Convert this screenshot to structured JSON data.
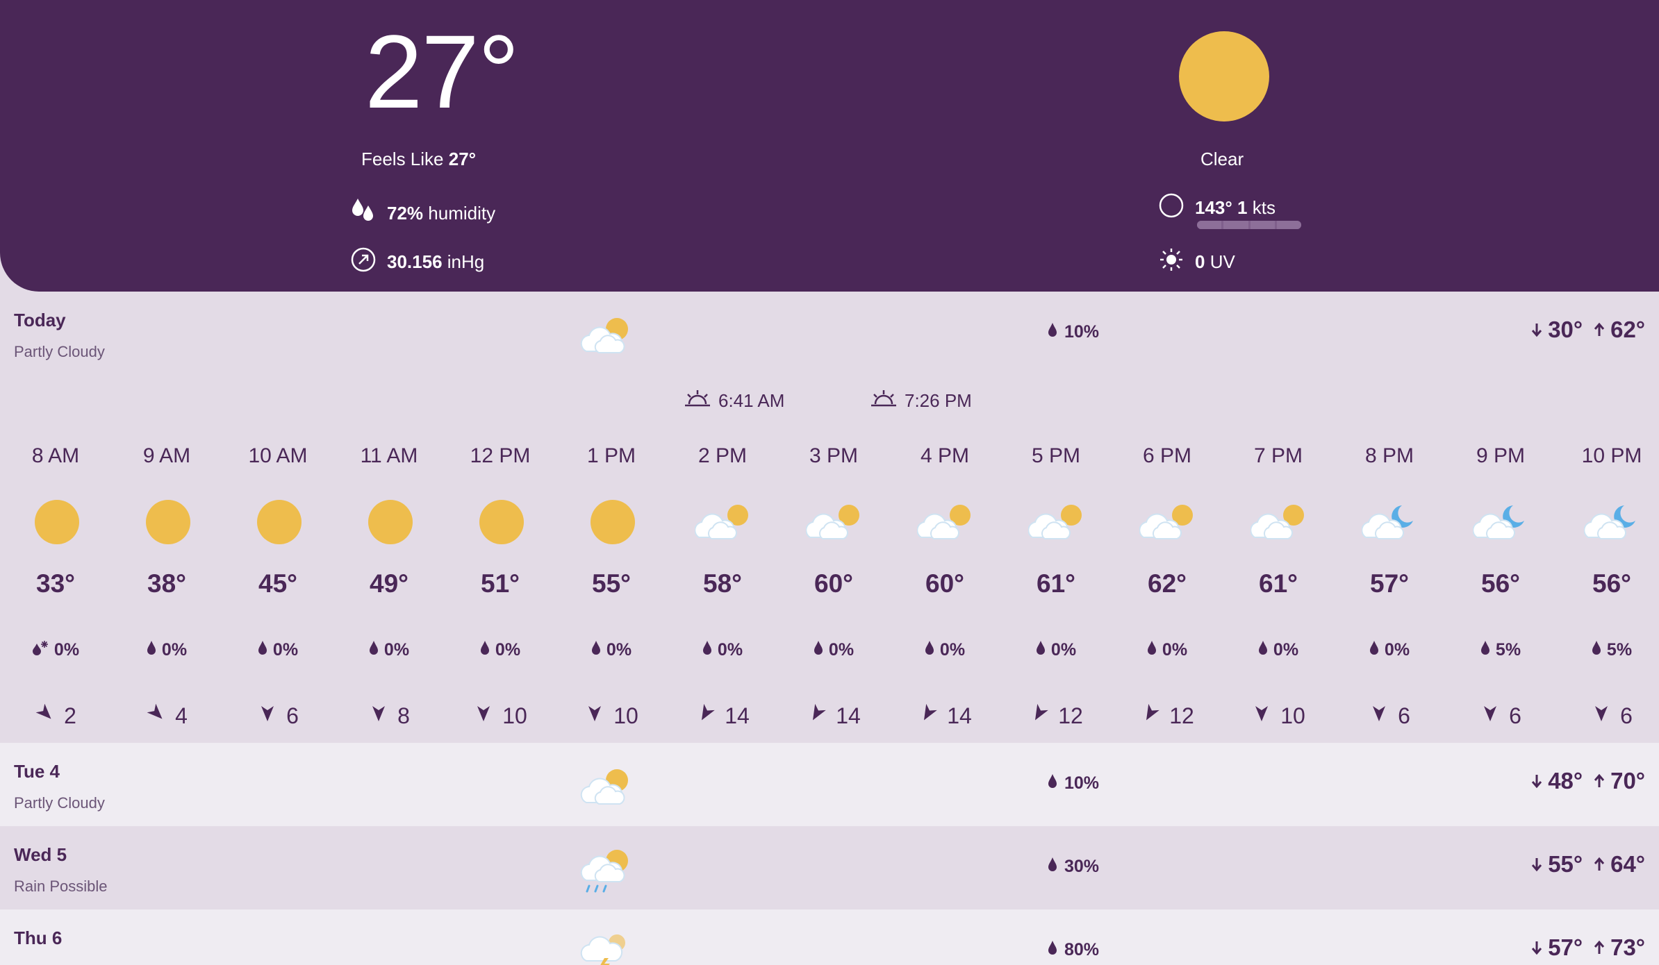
{
  "current": {
    "temperature": "27°",
    "feels_like_label": "Feels Like",
    "feels_like_value": "27°",
    "humidity_value": "72%",
    "humidity_label": "humidity",
    "pressure_value": "30.156",
    "pressure_unit": "inHg",
    "condition": "Clear",
    "wind_direction": "143°",
    "wind_speed": "1",
    "wind_unit": "kts",
    "uv_value": "0",
    "uv_label": "UV"
  },
  "today": {
    "day": "Today",
    "condition": "Partly Cloudy",
    "precip": "10%",
    "low": "30°",
    "high": "62°",
    "sunrise": "6:41 AM",
    "sunset": "7:26 PM"
  },
  "hours": [
    {
      "time": "8 AM",
      "icon": "sun-icon",
      "temp": "33°",
      "precip_icon": "snow-drop-icon",
      "precip": "0%",
      "wind_dir": "se",
      "wind": "2"
    },
    {
      "time": "9 AM",
      "icon": "sun-icon",
      "temp": "38°",
      "precip_icon": "drop-icon",
      "precip": "0%",
      "wind_dir": "se",
      "wind": "4"
    },
    {
      "time": "10 AM",
      "icon": "sun-icon",
      "temp": "45°",
      "precip_icon": "drop-icon",
      "precip": "0%",
      "wind_dir": "s",
      "wind": "6"
    },
    {
      "time": "11 AM",
      "icon": "sun-icon",
      "temp": "49°",
      "precip_icon": "drop-icon",
      "precip": "0%",
      "wind_dir": "s",
      "wind": "8"
    },
    {
      "time": "12 PM",
      "icon": "sun-icon",
      "temp": "51°",
      "precip_icon": "drop-icon",
      "precip": "0%",
      "wind_dir": "s",
      "wind": "10"
    },
    {
      "time": "1 PM",
      "icon": "sun-icon",
      "temp": "55°",
      "precip_icon": "drop-icon",
      "precip": "0%",
      "wind_dir": "s",
      "wind": "10"
    },
    {
      "time": "2 PM",
      "icon": "partly-cloudy-day-icon",
      "temp": "58°",
      "precip_icon": "drop-icon",
      "precip": "0%",
      "wind_dir": "sw",
      "wind": "14"
    },
    {
      "time": "3 PM",
      "icon": "partly-cloudy-day-icon",
      "temp": "60°",
      "precip_icon": "drop-icon",
      "precip": "0%",
      "wind_dir": "sw",
      "wind": "14"
    },
    {
      "time": "4 PM",
      "icon": "partly-cloudy-day-icon",
      "temp": "60°",
      "precip_icon": "drop-icon",
      "precip": "0%",
      "wind_dir": "sw",
      "wind": "14"
    },
    {
      "time": "5 PM",
      "icon": "partly-cloudy-day-icon",
      "temp": "61°",
      "precip_icon": "drop-icon",
      "precip": "0%",
      "wind_dir": "sw",
      "wind": "12"
    },
    {
      "time": "6 PM",
      "icon": "partly-cloudy-day-icon",
      "temp": "62°",
      "precip_icon": "drop-icon",
      "precip": "0%",
      "wind_dir": "sw",
      "wind": "12"
    },
    {
      "time": "7 PM",
      "icon": "partly-cloudy-day-icon",
      "temp": "61°",
      "precip_icon": "drop-icon",
      "precip": "0%",
      "wind_dir": "s",
      "wind": "10"
    },
    {
      "time": "8 PM",
      "icon": "partly-cloudy-night-icon",
      "temp": "57°",
      "precip_icon": "drop-icon",
      "precip": "0%",
      "wind_dir": "s",
      "wind": "6"
    },
    {
      "time": "9 PM",
      "icon": "partly-cloudy-night-icon",
      "temp": "56°",
      "precip_icon": "drop-icon",
      "precip": "5%",
      "wind_dir": "s",
      "wind": "6"
    },
    {
      "time": "10 PM",
      "icon": "partly-cloudy-night-icon",
      "temp": "56°",
      "precip_icon": "drop-icon",
      "precip": "5%",
      "wind_dir": "s",
      "wind": "6"
    }
  ],
  "days": [
    {
      "day": "Tue 4",
      "condition": "Partly Cloudy",
      "icon": "partly-cloudy-day-icon",
      "precip": "10%",
      "low": "48°",
      "high": "70°"
    },
    {
      "day": "Wed 5",
      "condition": "Rain Possible",
      "icon": "rain-day-icon",
      "precip": "30%",
      "low": "55°",
      "high": "64°"
    },
    {
      "day": "Thu 6",
      "condition": "",
      "icon": "thunderstorm-icon",
      "precip": "80%",
      "low": "57°",
      "high": "73°"
    }
  ],
  "colors": {
    "header_bg": "#4a2757",
    "panel_bg": "#e3dbe6",
    "row_alt_bg": "#efecf2",
    "sun": "#eebd4d",
    "moon": "#5aaee6",
    "text": "#4a2757"
  }
}
